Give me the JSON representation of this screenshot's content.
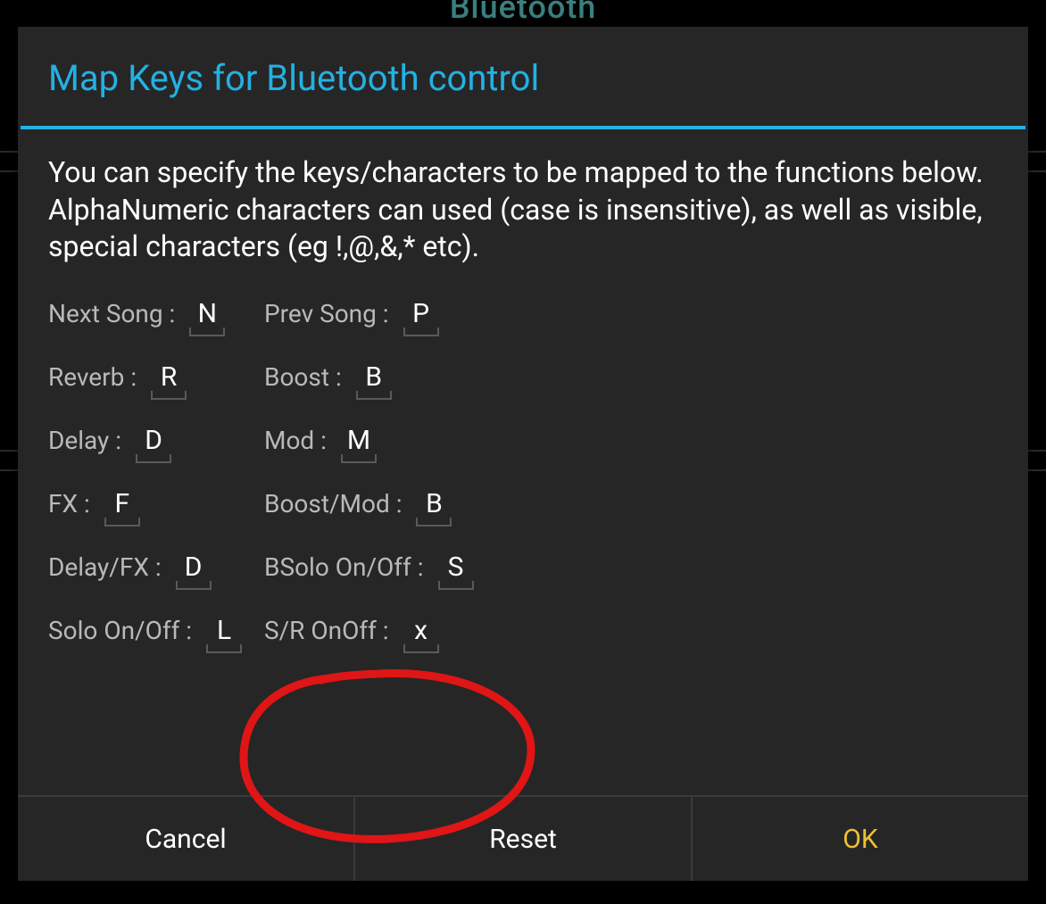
{
  "background": {
    "header_text": "Bluetooth"
  },
  "dialog": {
    "title": "Map Keys for Bluetooth control",
    "description": "You can specify the keys/characters to be mapped to the functions below. AlphaNumeric characters can used (case is insensitive), as well as visible, special characters (eg !,@,&,* etc).",
    "fields": [
      {
        "label1": "Next Song :",
        "value1": "N",
        "label2": "Prev Song :",
        "value2": "P"
      },
      {
        "label1": "Reverb :",
        "value1": "R",
        "label2": "Boost :",
        "value2": "B"
      },
      {
        "label1": "Delay :",
        "value1": "D",
        "label2": "Mod :",
        "value2": "M"
      },
      {
        "label1": "FX :",
        "value1": "F",
        "label2": "Boost/Mod :",
        "value2": "B"
      },
      {
        "label1": "Delay/FX :",
        "value1": "D",
        "label2": "BSolo On/Off :",
        "value2": "S"
      },
      {
        "label1": "Solo On/Off :",
        "value1": "L",
        "label2": "S/R OnOff :",
        "value2": "x"
      }
    ],
    "buttons": {
      "cancel": "Cancel",
      "reset": "Reset",
      "ok": "OK"
    }
  }
}
